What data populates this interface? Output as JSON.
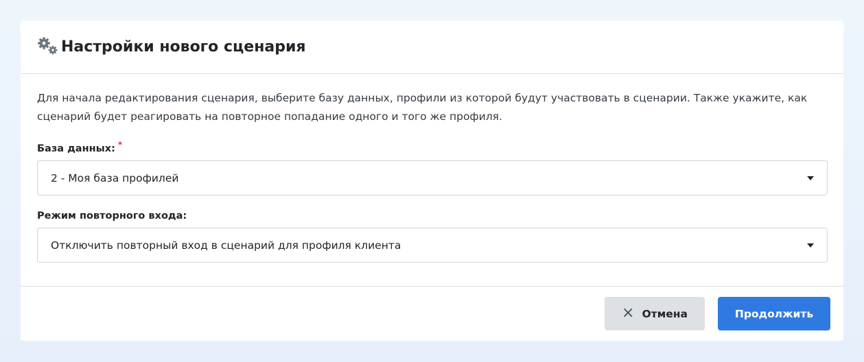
{
  "dialog": {
    "title": "Настройки нового сценария",
    "title_icon": "gears-icon",
    "description": "Для начала редактирования сценария, выберите базу данных, профили из которой будут участвовать в сценарии. Также укажите, как сценарий будет реагировать на повторное попадание одного и того же профиля."
  },
  "database_field": {
    "label": "База данных:",
    "required_mark": "*",
    "selected": "2 - Моя база профилей"
  },
  "reentry_field": {
    "label": "Режим повторного входа:",
    "selected": "Отключить повторный вход в сценарий для профиля клиента"
  },
  "footer": {
    "cancel_label": "Отмена",
    "cancel_icon": "×",
    "continue_label": "Продолжить"
  },
  "colors": {
    "primary": "#2f7ae0",
    "secondary": "#dde0e4",
    "required": "#dc3545"
  }
}
